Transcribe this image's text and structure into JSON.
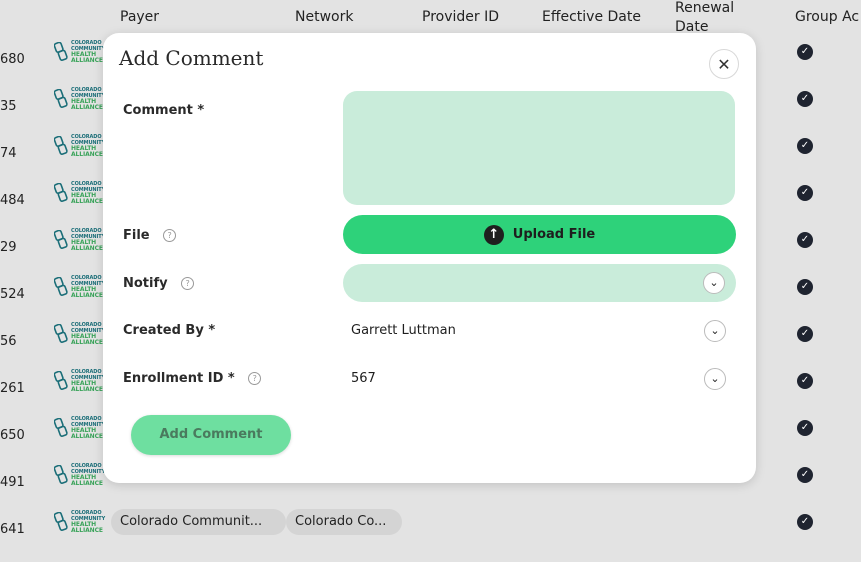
{
  "table": {
    "headers": {
      "payer": "Payer",
      "network": "Network",
      "provider_id": "Provider ID",
      "effective_date": "Effective Date",
      "renewal_date": "Renewal Date",
      "group_active": "Group Ac"
    },
    "logo_text": {
      "line1": "COLORADO",
      "line2": "COMMUNITY",
      "line3": "HEALTH",
      "line4": "ALLIANCE"
    },
    "rows": [
      {
        "id": "680"
      },
      {
        "id": "35"
      },
      {
        "id": "74"
      },
      {
        "id": "484"
      },
      {
        "id": "29"
      },
      {
        "id": "524"
      },
      {
        "id": "56"
      },
      {
        "id": "261"
      },
      {
        "id": "650"
      },
      {
        "id": "491"
      },
      {
        "id": "641",
        "payer": "Colorado Communit...",
        "network": "Colorado Co..."
      }
    ]
  },
  "modal": {
    "title": "Add Comment",
    "close_icon": "close-icon",
    "comment_label": "Comment *",
    "file_label": "File",
    "upload_label": "Upload File",
    "notify_label": "Notify",
    "created_by_label": "Created By *",
    "created_by_value": "Garrett Luttman",
    "enrollment_label": "Enrollment ID *",
    "enrollment_value": "567",
    "submit_label": "Add Comment",
    "help_glyph": "?"
  },
  "colors": {
    "accent": "#2ed27a",
    "field_bg": "#c9ecda",
    "submit_bg": "#6edfa0"
  }
}
